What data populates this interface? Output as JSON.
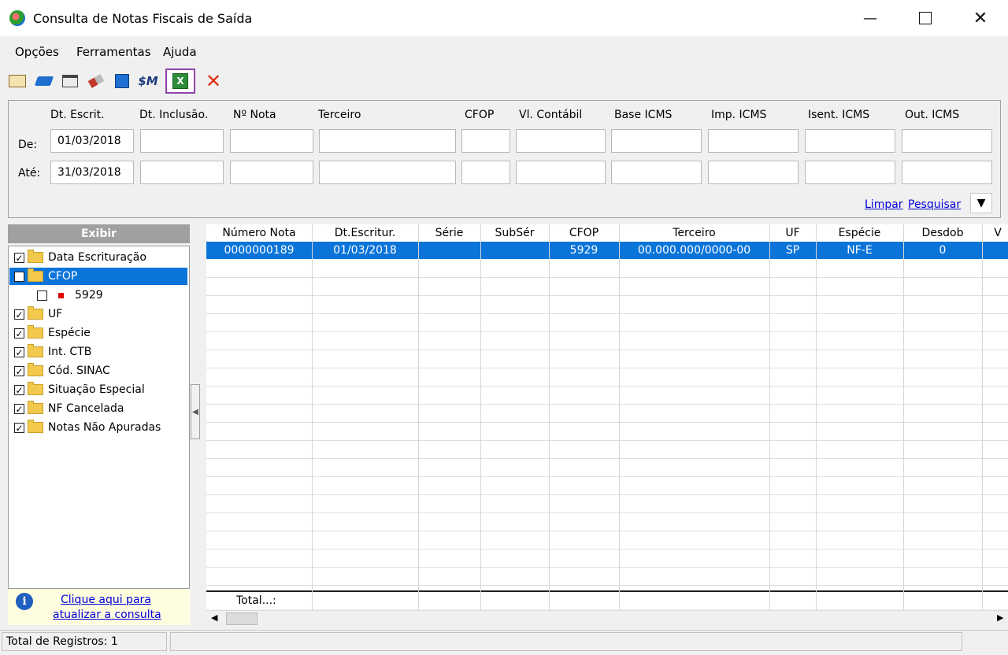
{
  "window": {
    "title": "Consulta de Notas Fiscais de Saída"
  },
  "menu": [
    "Opções",
    "Ferramentas",
    "Ajuda"
  ],
  "toolbar": {
    "icons": [
      "book-icon",
      "blue-book-icon",
      "window-icon",
      "eraser-icon",
      "calculator-icon",
      "tax-icon",
      "excel-export-icon",
      "close-x-icon"
    ],
    "close_color": "#e03010",
    "highlight_color": "#8e44ad"
  },
  "filters": {
    "headers": [
      "Dt. Escrit.",
      "Dt. Inclusão.",
      "Nº Nota",
      "Terceiro",
      "CFOP",
      "Vl. Contábil",
      "Base ICMS",
      "Imp. ICMS",
      "Isent. ICMS",
      "Out. ICMS"
    ],
    "from_label": "De:",
    "to_label": "Até:",
    "from_date": "01/03/2018",
    "to_date": "31/03/2018",
    "clear_label": "Limpar",
    "search_label": "Pesquisar"
  },
  "tree": {
    "title": "Exibir",
    "items": [
      {
        "label": "Data Escrituração",
        "checked": true
      },
      {
        "label": "CFOP",
        "checked": false,
        "selected": true
      },
      {
        "label": "5929",
        "checked": false,
        "child": true
      },
      {
        "label": "UF",
        "checked": true
      },
      {
        "label": "Espécie",
        "checked": true
      },
      {
        "label": "Int. CTB",
        "checked": true
      },
      {
        "label": "Cód. SINAC",
        "checked": true
      },
      {
        "label": "Situação Especial",
        "checked": true
      },
      {
        "label": "NF Cancelada",
        "checked": true
      },
      {
        "label": "Notas Não Apuradas",
        "checked": true
      }
    ],
    "refresh_line1": "Clique aqui para",
    "refresh_line2": "atualizar a consulta"
  },
  "grid": {
    "columns": [
      "Número Nota",
      "Dt.Escritur.",
      "Série",
      "SubSér",
      "CFOP",
      "Terceiro",
      "UF",
      "Espécie",
      "Desdob",
      "V"
    ],
    "rows": [
      [
        "0000000189",
        "01/03/2018",
        "",
        "",
        "5929",
        "00.000.000/0000-00",
        "SP",
        "NF-E",
        "0",
        ""
      ]
    ],
    "total_label": "Total...:",
    "selection_color": "#0a74d9"
  },
  "status": {
    "records": "Total de Registros: 1"
  }
}
